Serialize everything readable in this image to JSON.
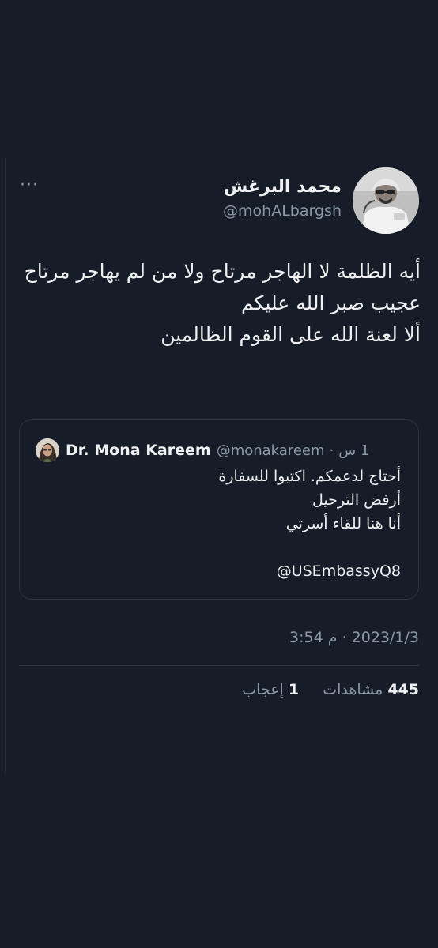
{
  "tweet": {
    "author": {
      "name": "محمد البرغش",
      "handle": "@mohALbargsh"
    },
    "more_label": "···",
    "lines": [
      "أيه الظلمة لا الهاجر مرتاح ولا من لم يهاجر مرتاح",
      "عجيب صبر الله عليكم",
      "ألا لعنة الله على القوم الظالمين"
    ],
    "timestamp": {
      "date": "2023/1/3",
      "separator": "·",
      "time": "3:54 م"
    },
    "stats": {
      "views_count": "445",
      "views_label": "مشاهدات",
      "likes_count": "1",
      "likes_label": "إعجاب"
    }
  },
  "quote": {
    "name": "Dr. Mona Kareem",
    "handle": "@monakareem",
    "separator": "·",
    "time": "1 س",
    "lines": [
      "أحتاج لدعمكم. اكتبوا للسفارة",
      "أرفض الترحيل",
      "أنا هنا للقاء أسرتي"
    ],
    "mention": "@USEmbassyQ8"
  }
}
